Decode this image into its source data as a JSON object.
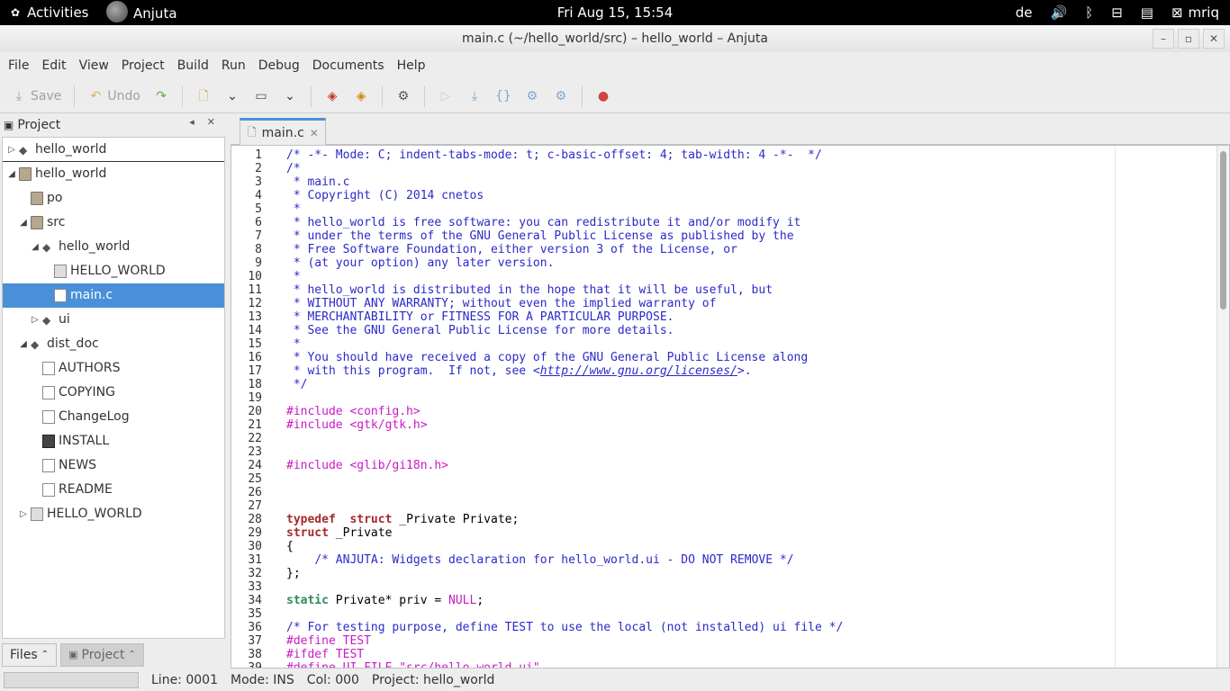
{
  "topbar": {
    "activities": "Activities",
    "app_name": "Anjuta",
    "clock": "Fri Aug 15, 15:54",
    "keyboard_layout": "de",
    "user": "mriq"
  },
  "window": {
    "title": "main.c (~/hello_world/src) – hello_world – Anjuta"
  },
  "menu": [
    "File",
    "Edit",
    "View",
    "Project",
    "Build",
    "Run",
    "Debug",
    "Documents",
    "Help"
  ],
  "toolbar": {
    "save_label": "Save",
    "undo_label": "Undo"
  },
  "left_panel": {
    "title": "Project",
    "tree": [
      {
        "label": "hello_world",
        "icon": "project-icon",
        "expander": "collapsed",
        "depth": 0,
        "divider": true
      },
      {
        "label": "hello_world",
        "icon": "folder-icon",
        "expander": "expanded",
        "depth": 0
      },
      {
        "label": "po",
        "icon": "folder-icon",
        "expander": "none",
        "depth": 1
      },
      {
        "label": "src",
        "icon": "folder-icon",
        "expander": "expanded",
        "depth": 1
      },
      {
        "label": "hello_world",
        "icon": "project-icon",
        "expander": "expanded",
        "depth": 2
      },
      {
        "label": "HELLO_WORLD",
        "icon": "library-icon",
        "expander": "none",
        "depth": 3
      },
      {
        "label": "main.c",
        "icon": "document-icon",
        "expander": "none",
        "depth": 3,
        "selected": true
      },
      {
        "label": "ui",
        "icon": "project-icon",
        "expander": "collapsed",
        "depth": 2
      },
      {
        "label": "dist_doc",
        "icon": "project-icon",
        "expander": "expanded",
        "depth": 1
      },
      {
        "label": "AUTHORS",
        "icon": "document-icon",
        "expander": "none",
        "depth": 2
      },
      {
        "label": "COPYING",
        "icon": "document-icon",
        "expander": "none",
        "depth": 2
      },
      {
        "label": "ChangeLog",
        "icon": "document-icon",
        "expander": "none",
        "depth": 2
      },
      {
        "label": "INSTALL",
        "icon": "terminal-icon",
        "expander": "none",
        "depth": 2
      },
      {
        "label": "NEWS",
        "icon": "document-icon",
        "expander": "none",
        "depth": 2
      },
      {
        "label": "README",
        "icon": "document-icon",
        "expander": "none",
        "depth": 2
      },
      {
        "label": "HELLO_WORLD",
        "icon": "library-icon",
        "expander": "collapsed",
        "depth": 1
      }
    ],
    "bottom_tabs": [
      "Files",
      "Project"
    ]
  },
  "editor": {
    "tab_label": "main.c",
    "lines": [
      [
        [
          "cm",
          "/* -*- Mode: C; indent-tabs-mode: t; c-basic-offset: 4; tab-width: 4 -*-  */"
        ]
      ],
      [
        [
          "cm",
          "/*"
        ]
      ],
      [
        [
          "cm",
          " * main.c"
        ]
      ],
      [
        [
          "cm",
          " * Copyright (C) 2014 cnetos"
        ]
      ],
      [
        [
          "cm",
          " *"
        ]
      ],
      [
        [
          "cm",
          " * hello_world is free software: you can redistribute it and/or modify it"
        ]
      ],
      [
        [
          "cm",
          " * under the terms of the GNU General Public License as published by the"
        ]
      ],
      [
        [
          "cm",
          " * Free Software Foundation, either version 3 of the License, or"
        ]
      ],
      [
        [
          "cm",
          " * (at your option) any later version."
        ]
      ],
      [
        [
          "cm",
          " *"
        ]
      ],
      [
        [
          "cm",
          " * hello_world is distributed in the hope that it will be useful, but"
        ]
      ],
      [
        [
          "cm",
          " * WITHOUT ANY WARRANTY; without even the implied warranty of"
        ]
      ],
      [
        [
          "cm",
          " * MERCHANTABILITY or FITNESS FOR A PARTICULAR PURPOSE."
        ]
      ],
      [
        [
          "cm",
          " * See the GNU General Public License for more details."
        ]
      ],
      [
        [
          "cm",
          " *"
        ]
      ],
      [
        [
          "cm",
          " * You should have received a copy of the GNU General Public License along"
        ]
      ],
      [
        [
          "cm",
          " * with this program.  If not, see <"
        ],
        [
          "lk",
          "http://www.gnu.org/licenses/"
        ],
        [
          "cm",
          ">."
        ]
      ],
      [
        [
          "cm",
          " */"
        ]
      ],
      [],
      [
        [
          "pp",
          "#include <config.h>"
        ]
      ],
      [
        [
          "pp",
          "#include <gtk/gtk.h>"
        ]
      ],
      [],
      [],
      [
        [
          "pp",
          "#include <glib/gi18n.h>"
        ]
      ],
      [],
      [],
      [],
      [
        [
          "kw",
          "typedef"
        ],
        [
          "",
          "  "
        ],
        [
          "kw",
          "struct"
        ],
        [
          "",
          " _Private Private;"
        ]
      ],
      [
        [
          "kw",
          "struct"
        ],
        [
          "",
          " _Private"
        ]
      ],
      [
        [
          "",
          "{"
        ]
      ],
      [
        [
          "",
          "    "
        ],
        [
          "cm",
          "/* ANJUTA: Widgets declaration for hello_world.ui - DO NOT REMOVE */"
        ]
      ],
      [
        [
          "",
          "};"
        ]
      ],
      [],
      [
        [
          "ty",
          "static"
        ],
        [
          "",
          " Private* priv = "
        ],
        [
          "cn",
          "NULL"
        ],
        [
          "",
          ";"
        ]
      ],
      [],
      [
        [
          "cm",
          "/* For testing purpose, define TEST to use the local (not installed) ui file */"
        ]
      ],
      [
        [
          "pp",
          "#define TEST"
        ]
      ],
      [
        [
          "pp",
          "#ifdef TEST"
        ]
      ],
      [
        [
          "pp",
          "#define UI_FILE \"src/hello_world.ui\""
        ]
      ]
    ]
  },
  "status": {
    "line": "Line: 0001",
    "mode": "Mode: INS",
    "col": "Col: 000",
    "project": "Project: hello_world"
  }
}
